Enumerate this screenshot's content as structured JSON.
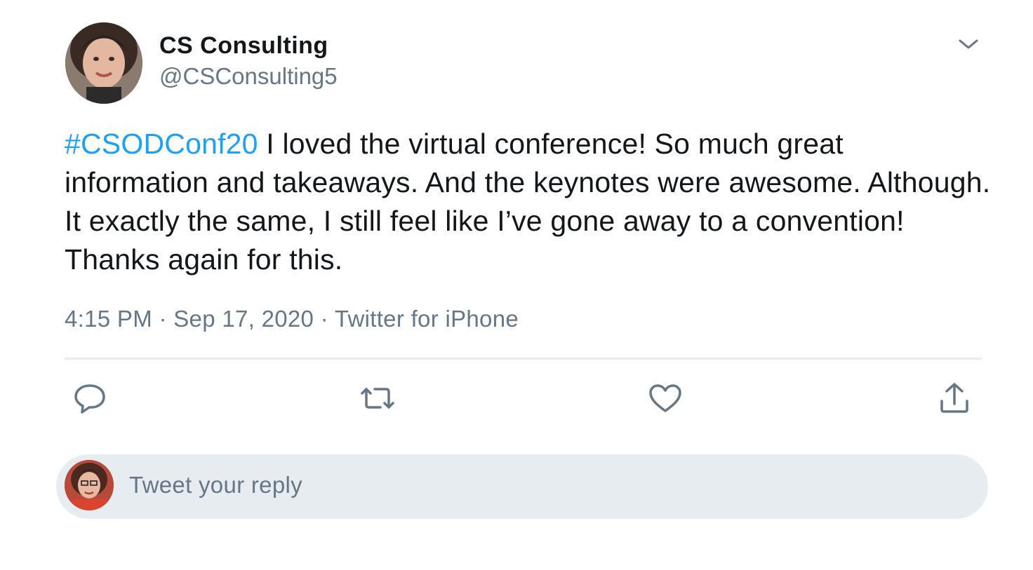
{
  "user": {
    "display_name": "CS Consulting",
    "handle": "@CSConsulting5"
  },
  "tweet": {
    "hashtag": "#CSODConf20",
    "text": " I loved the virtual conference! So much great information and takeaways. And the keynotes were awesome. Although. It exactly the same, I still feel like I’ve gone away to a convention! Thanks again for this.",
    "time": "4:15 PM",
    "separator": " · ",
    "date": "Sep 17, 2020",
    "source": "Twitter for iPhone"
  },
  "actions": {
    "reply_icon": "comment-bubble-icon",
    "retweet_icon": "retweet-arrows-icon",
    "like_icon": "heart-outline-icon",
    "share_icon": "share-upload-icon"
  },
  "reply": {
    "placeholder": "Tweet your reply"
  },
  "colors": {
    "accent": "#1da1f2",
    "secondary_text": "#657786",
    "divider": "#e6ecf0",
    "reply_bar": "#e6ecf0"
  }
}
